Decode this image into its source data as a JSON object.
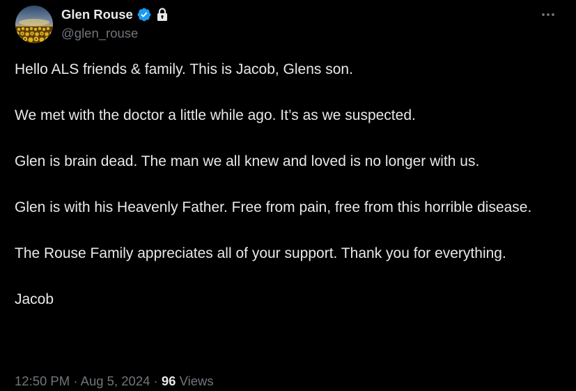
{
  "author": {
    "display_name": "Glen Rouse",
    "handle": "@glen_rouse",
    "verified": true,
    "protected": true
  },
  "icons": {
    "verified": "verified-badge-icon",
    "lock": "lock-icon",
    "more": "more-horizontal-icon"
  },
  "colors": {
    "background": "#000000",
    "text_primary": "#e7e9ea",
    "text_secondary": "#71767b",
    "verified_blue": "#1d9bf0"
  },
  "tweet": {
    "paragraphs": [
      "Hello ALS friends & family. This is Jacob, Glens son.",
      "We met with the doctor a little while ago. It’s as we suspected.",
      "Glen is brain dead. The man we all knew and loved is no longer with us.",
      "Glen is with his Heavenly Father. Free from pain, free from this horrible disease.",
      "The Rouse Family appreciates all of your support. Thank you for everything.",
      "Jacob"
    ]
  },
  "meta": {
    "time": "12:50 PM",
    "separator": "·",
    "date": "Aug 5, 2024",
    "views_count": "96",
    "views_label": "Views"
  }
}
